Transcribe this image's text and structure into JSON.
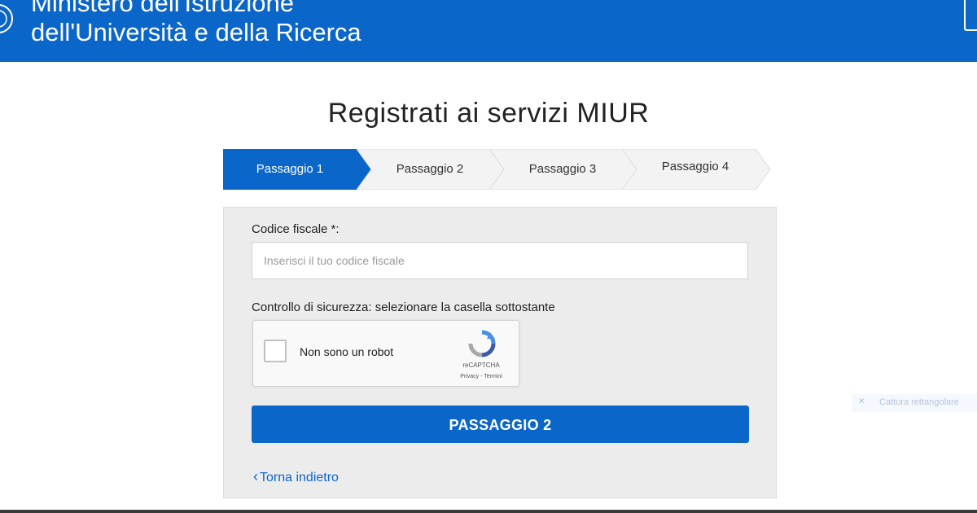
{
  "header": {
    "title_line1": "Ministero dell'Istruzione",
    "title_line2": "dell'Università e della Ricerca"
  },
  "page": {
    "title": "Registrati ai servizi MIUR"
  },
  "stepper": {
    "steps": [
      {
        "label": "Passaggio 1",
        "active": true
      },
      {
        "label": "Passaggio 2",
        "active": false
      },
      {
        "label": "Passaggio 3",
        "active": false
      },
      {
        "label": "Passaggio 4",
        "active": false
      }
    ]
  },
  "form": {
    "codice_label": "Codice fiscale *:",
    "codice_placeholder": "Inserisci il tuo codice fiscale",
    "codice_value": "",
    "captcha_label": "Controllo di sicurezza: selezionare la casella sottostante",
    "captcha": {
      "checkbox_label": "Non sono un robot",
      "brand": "reCAPTCHA",
      "terms": "Privacy - Termini",
      "checked": false
    },
    "submit_label": "PASSAGGIO 2",
    "back_label": "Torna indietro"
  },
  "ghost_tooltip": {
    "text": "Cattura rettangolare"
  },
  "colors": {
    "brand_blue": "#0b66c9",
    "panel_bg": "#ececec",
    "step_inactive": "#f2f2f2"
  },
  "icons": [
    "emblem-icon",
    "chevron-left-icon",
    "recaptcha-icon",
    "close-icon"
  ]
}
